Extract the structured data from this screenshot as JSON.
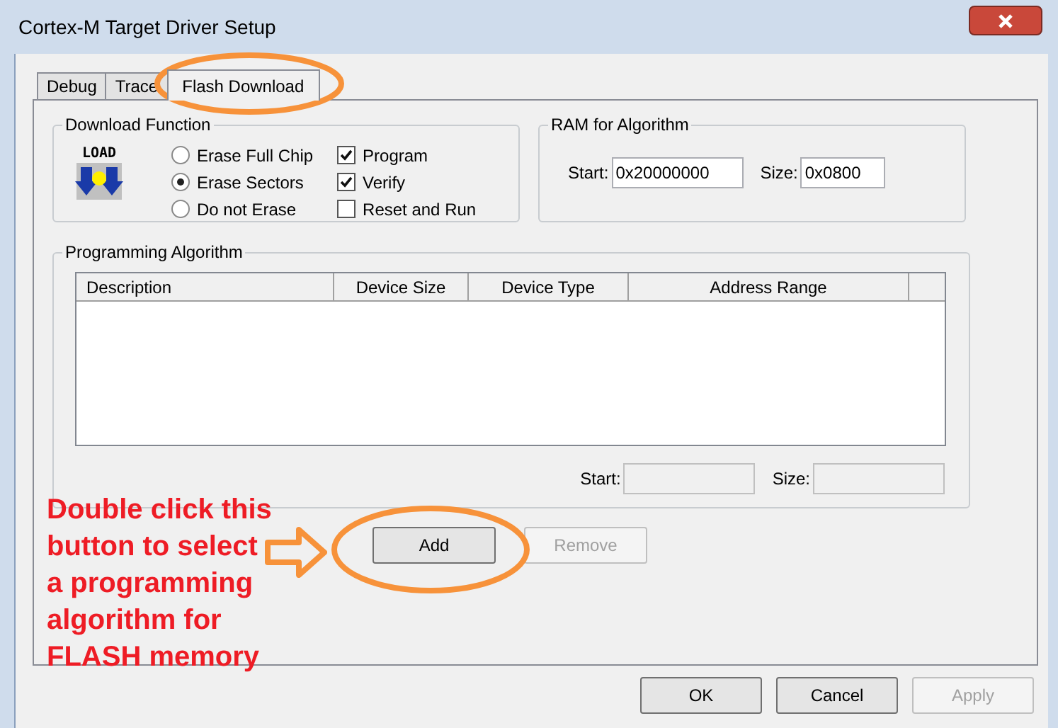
{
  "window": {
    "title": "Cortex-M Target Driver Setup"
  },
  "tabs": [
    {
      "label": "Debug",
      "selected": false
    },
    {
      "label": "Trace",
      "selected": false
    },
    {
      "label": "Flash Download",
      "selected": true
    }
  ],
  "download_function": {
    "title": "Download Function",
    "icon_text": "LOAD",
    "erase_options": [
      {
        "label": "Erase Full Chip",
        "selected": false
      },
      {
        "label": "Erase Sectors",
        "selected": true
      },
      {
        "label": "Do not Erase",
        "selected": false
      }
    ],
    "options": [
      {
        "label": "Program",
        "checked": true
      },
      {
        "label": "Verify",
        "checked": true
      },
      {
        "label": "Reset and Run",
        "checked": false
      }
    ]
  },
  "ram_for_algorithm": {
    "title": "RAM for Algorithm",
    "start_label": "Start:",
    "start": "0x20000000",
    "size_label": "Size:",
    "size": "0x0800"
  },
  "programming_algorithm": {
    "title": "Programming Algorithm",
    "columns": [
      "Description",
      "Device Size",
      "Device Type",
      "Address Range"
    ],
    "start_label": "Start:",
    "size_label": "Size:"
  },
  "algorithm_buttons": [
    {
      "label": "Add",
      "disabled": false
    },
    {
      "label": "Remove",
      "disabled": true
    }
  ],
  "dialog_buttons": [
    {
      "label": "OK",
      "disabled": false
    },
    {
      "label": "Cancel",
      "disabled": false
    },
    {
      "label": "Apply",
      "disabled": true
    }
  ],
  "annotation": {
    "text": "Double click this button to select a programming algorithm for FLASH memory"
  }
}
